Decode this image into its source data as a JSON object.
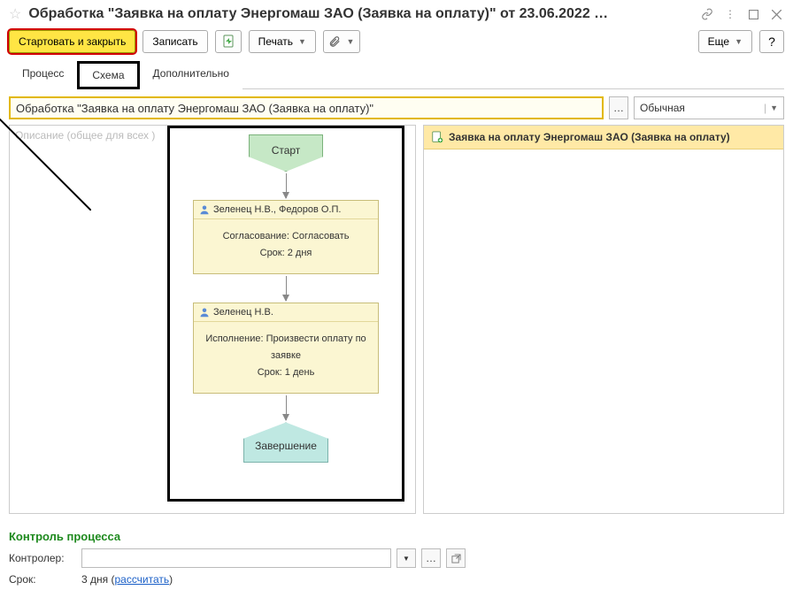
{
  "titlebar": {
    "title": "Обработка \"Заявка на оплату Энергомаш ЗАО (Заявка на оплату)\" от 23.06.2022 …"
  },
  "toolbar": {
    "start_close": "Стартовать и закрыть",
    "write": "Записать",
    "print": "Печать",
    "more": "Еще",
    "help": "?"
  },
  "tabs": {
    "process": "Процесс",
    "scheme": "Схема",
    "extra": "Дополнительно"
  },
  "name_field": "Обработка \"Заявка на оплату Энергомаш ЗАО (Заявка на оплату)\"",
  "importance": "Обычная",
  "desc_placeholder": "Описание (общее для всех )",
  "diagram": {
    "start": "Старт",
    "task1_assignees": "Зеленец Н.В., Федоров О.П.",
    "task1_line1": "Согласование: Согласовать",
    "task1_line2": "Срок: 2 дня",
    "task2_assignees": "Зеленец Н.В.",
    "task2_line1": "Исполнение: Произвести оплату по заявке",
    "task2_line2": "Срок: 1 день",
    "end": "Завершение"
  },
  "rightpane": {
    "header": "Заявка на оплату Энергомаш ЗАО (Заявка на оплату)"
  },
  "footer": {
    "section": "Контроль процесса",
    "controller_label": "Контролер:",
    "term_label": "Срок:",
    "term_value": "3 дня (",
    "term_link": "рассчитать",
    "term_close": ")"
  }
}
